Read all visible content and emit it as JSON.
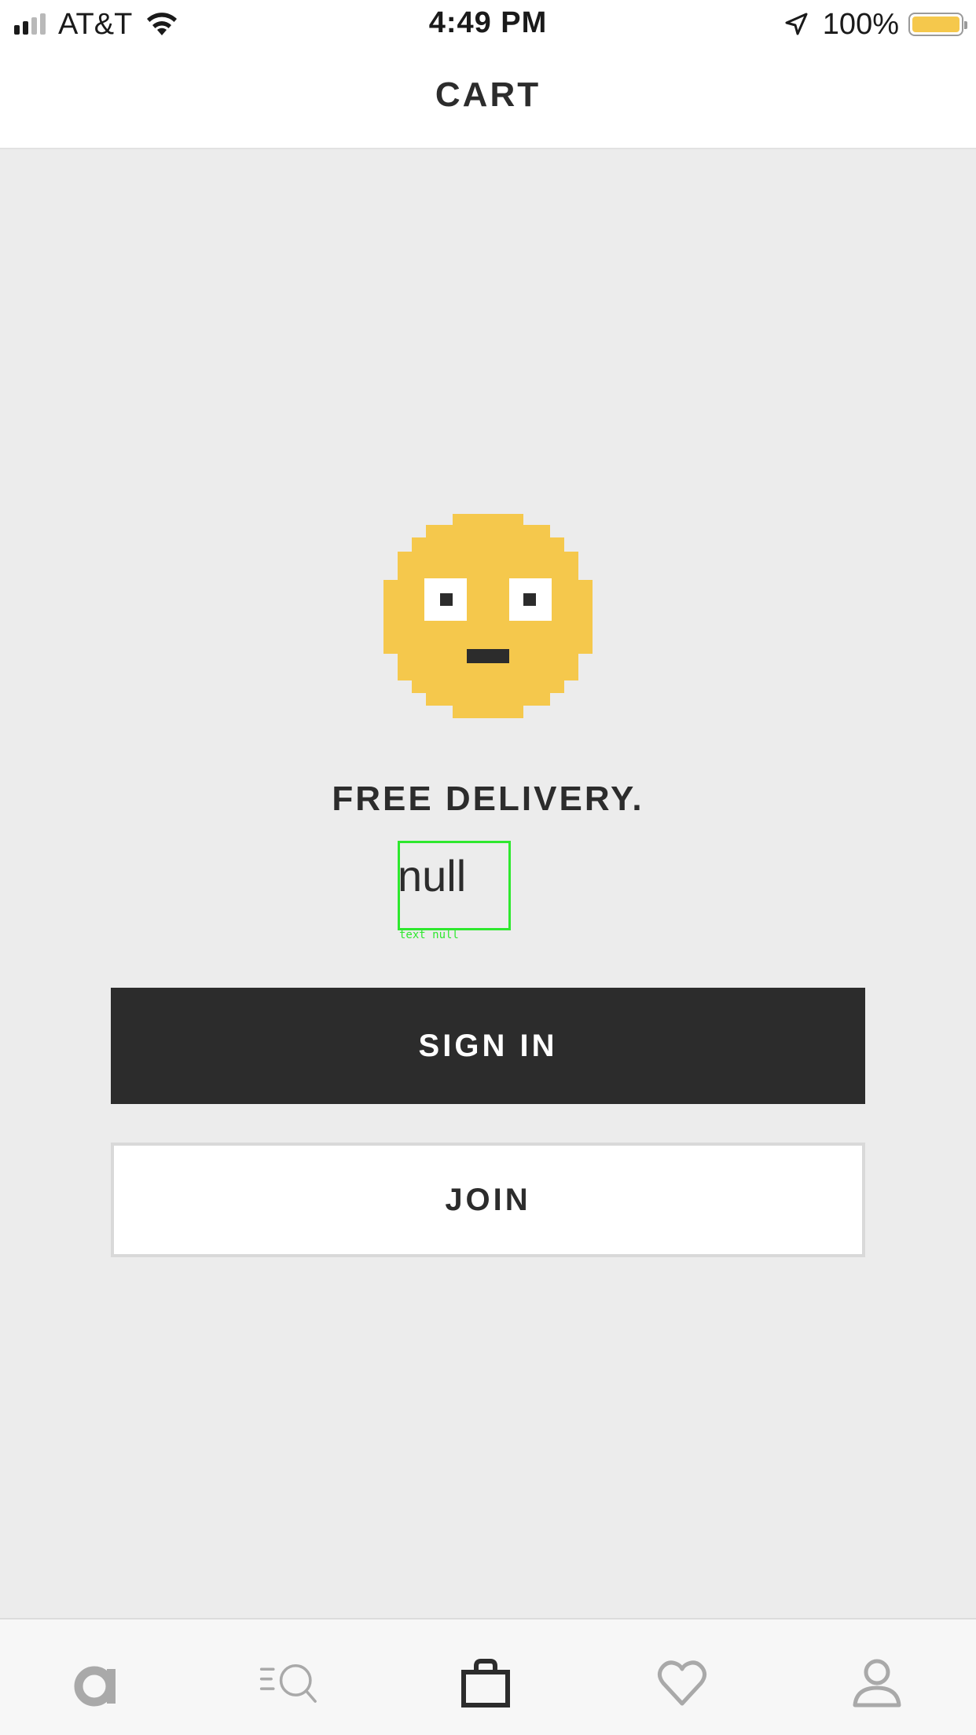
{
  "status_bar": {
    "carrier": "AT&T",
    "time": "4:49 PM",
    "battery_percent": "100%",
    "signal_bars_filled": 2,
    "signal_bars_total": 4,
    "battery_color": "#f5c84c"
  },
  "header": {
    "title": "CART"
  },
  "empty_state": {
    "icon": "pixel-face-icon",
    "headline": "FREE DELIVERY.",
    "subtext": "null",
    "debug_label": "text null",
    "icon_color": "#f5c84c"
  },
  "actions": {
    "sign_in_label": "SIGN IN",
    "join_label": "JOIN"
  },
  "tab_bar": {
    "items": [
      {
        "icon": "home-logo-icon",
        "active": false
      },
      {
        "icon": "search-menu-icon",
        "active": false
      },
      {
        "icon": "cart-bag-icon",
        "active": true
      },
      {
        "icon": "heart-icon",
        "active": false
      },
      {
        "icon": "profile-icon",
        "active": false
      }
    ]
  },
  "colors": {
    "background": "#ececec",
    "dark": "#2c2c2c",
    "inactive_icon": "#a9a9a9"
  }
}
